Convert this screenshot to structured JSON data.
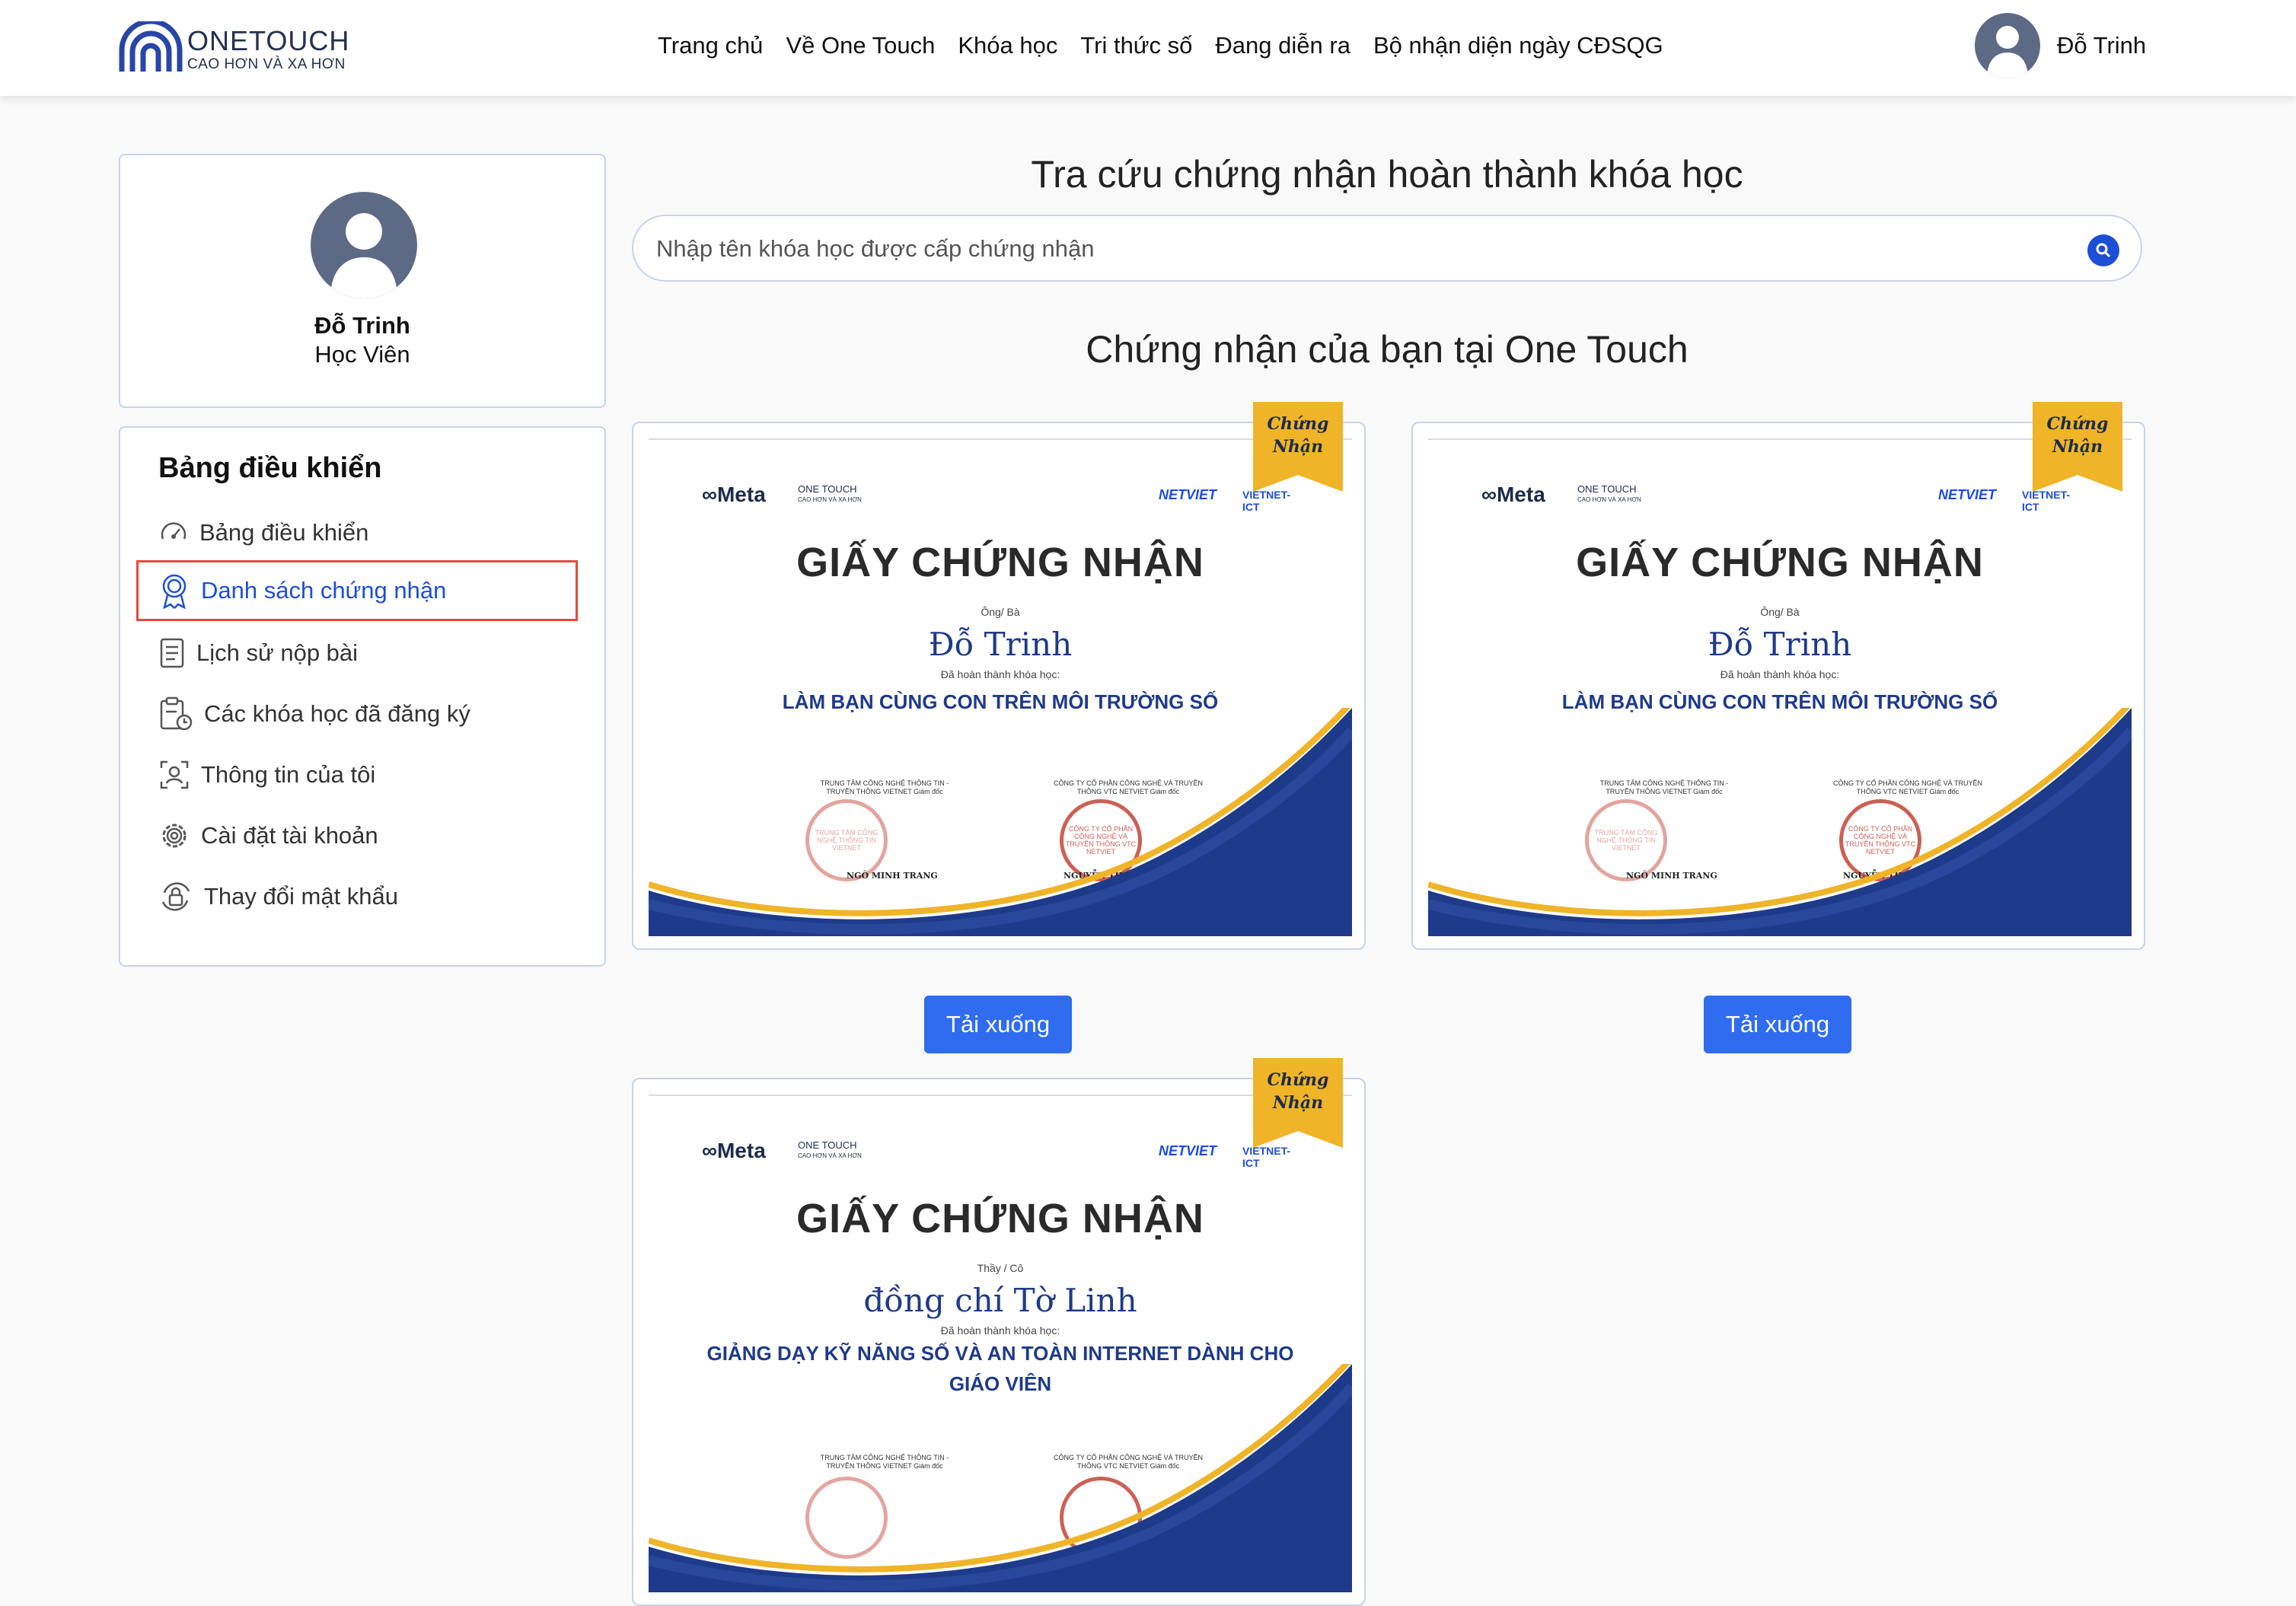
{
  "header": {
    "logo_name": "ONETOUCH",
    "logo_tag": "CAO HƠN VÀ XA HƠN",
    "nav": [
      "Trang chủ",
      "Về One Touch",
      "Khóa học",
      "Tri thức số",
      "Đang diễn ra",
      "Bộ nhận diện ngày CĐSQG"
    ],
    "user_name": "Đỗ Trinh"
  },
  "profile": {
    "name": "Đỗ Trinh",
    "role": "Học Viên"
  },
  "sidebar": {
    "title": "Bảng điều khiển",
    "items": [
      {
        "label": "Bảng điều khiển",
        "icon": "dashboard-gauge-icon"
      },
      {
        "label": "Danh sách chứng nhận",
        "icon": "award-ribbon-icon",
        "active": true
      },
      {
        "label": "Lịch sử nộp bài",
        "icon": "document-list-icon"
      },
      {
        "label": "Các khóa học đã đăng ký",
        "icon": "clipboard-clock-icon"
      },
      {
        "label": "Thông tin của tôi",
        "icon": "id-card-icon"
      },
      {
        "label": "Cài đặt tài khoản",
        "icon": "gear-icon"
      },
      {
        "label": "Thay đổi mật khẩu",
        "icon": "lock-refresh-icon"
      }
    ]
  },
  "main": {
    "title": "Tra cứu chứng nhận hoàn thành khóa học",
    "search_placeholder": "Nhập tên khóa học được cấp chứng nhận",
    "section_title": "Chứng nhận của bạn tại One Touch",
    "download_label": "Tải xuống"
  },
  "certificates": [
    {
      "meta": "Meta",
      "onetouch": "ONE TOUCH",
      "onetouch_tag": "CAO HƠN VÀ XA HƠN",
      "netviet": "NETVIET",
      "vietnet": "VIETNET-ICT",
      "title": "GIẤY CHỨNG NHẬN",
      "salute": "Ông/ Bà",
      "name": "Đỗ Trinh",
      "done": "Đã hoàn thành khóa học:",
      "course": "LÀM BẠN CÙNG CON TRÊN MÔI TRƯỜNG SỐ",
      "org_left": "TRUNG TÂM CÔNG NGHỆ THÔNG TIN - TRUYỀN THÔNG VIETNET Giám đốc",
      "org_right": "CÔNG TY CỔ PHẦN CÔNG NGHỆ VÀ TRUYỀN THÔNG VTC NETVIET Giám đốc",
      "signer_left": "NGÔ MINH TRANG",
      "signer_right": "NGUYỄN THỊ BÍCH HẠNH",
      "stamp_left": "TRUNG TÂM CÔNG NGHỆ THÔNG TIN VIETNET",
      "stamp_right": "CÔNG TY CỔ PHẦN CÔNG NGHỆ VÀ TRUYỀN THÔNG VTC NETVIET",
      "badge": "Chứng Nhận"
    },
    {
      "meta": "Meta",
      "onetouch": "ONE TOUCH",
      "onetouch_tag": "CAO HƠN VÀ XA HƠN",
      "netviet": "NETVIET",
      "vietnet": "VIETNET-ICT",
      "title": "GIẤY CHỨNG NHẬN",
      "salute": "Ông/ Bà",
      "name": "Đỗ Trinh",
      "done": "Đã hoàn thành khóa học:",
      "course": "LÀM BẠN CÙNG CON TRÊN MÔI TRƯỜNG SỐ",
      "org_left": "TRUNG TÂM CÔNG NGHỆ THÔNG TIN - TRUYỀN THÔNG VIETNET Giám đốc",
      "org_right": "CÔNG TY CỔ PHẦN CÔNG NGHỆ VÀ TRUYỀN THÔNG VTC NETVIET Giám đốc",
      "signer_left": "NGÔ MINH TRANG",
      "signer_right": "NGUYỄN THỊ BÍCH HẠNH",
      "stamp_left": "TRUNG TÂM CÔNG NGHỆ THÔNG TIN VIETNET",
      "stamp_right": "CÔNG TY CỔ PHẦN CÔNG NGHỆ VÀ TRUYỀN THÔNG VTC NETVIET",
      "badge": "Chứng Nhận"
    },
    {
      "meta": "Meta",
      "onetouch": "ONE TOUCH",
      "onetouch_tag": "CAO HƠN VÀ XA HƠN",
      "netviet": "NETVIET",
      "vietnet": "VIETNET-ICT",
      "title": "GIẤY CHỨNG NHẬN",
      "salute": "Thầy / Cô",
      "name": "đồng chí Tờ Linh",
      "done": "Đã hoàn thành khóa học:",
      "course": "GIẢNG DẠY KỸ NĂNG SỐ VÀ AN TOÀN INTERNET DÀNH CHO GIÁO VIÊN",
      "org_left": "TRUNG TÂM CÔNG NGHỆ THÔNG TIN - TRUYỀN THÔNG VIETNET Giám đốc",
      "org_right": "CÔNG TY CỔ PHẦN CÔNG NGHỆ VÀ TRUYỀN THÔNG VTC NETVIET Giám đốc",
      "signer_left": "",
      "signer_right": "",
      "stamp_left": "",
      "stamp_right": "",
      "badge": "Chứng Nhận"
    }
  ],
  "colors": {
    "accent": "#2f6cf0",
    "active": "#1d4ed8",
    "highlight_box": "#e34a3a",
    "card_border": "#c9d2ea",
    "cert_navy": "#1e3a8a",
    "gold": "#f0b429"
  }
}
